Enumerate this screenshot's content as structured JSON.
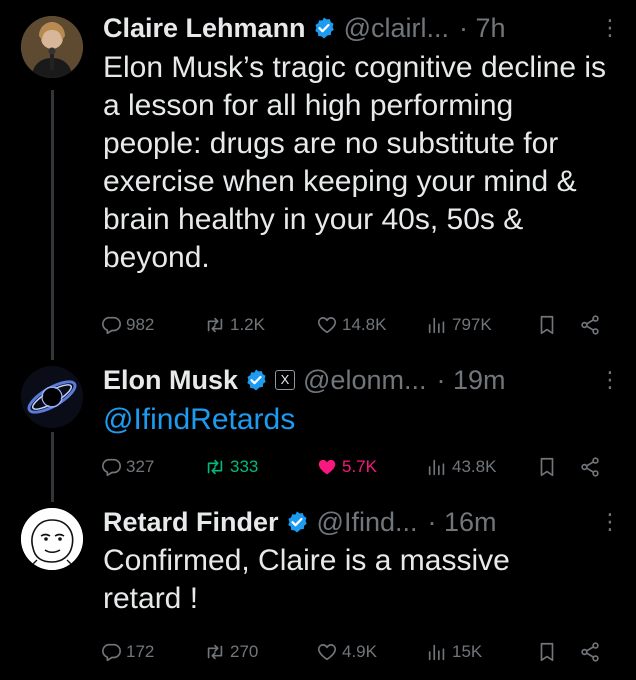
{
  "tweets": [
    {
      "name": "Claire Lehmann",
      "handle": "@clairl...",
      "time": "7h",
      "text": "Elon Musk’s tragic cognitive decline is a lesson for all high performing people: drugs are no substitute for exercise when keeping your mind & brain healthy in your 40s, 50s & beyond.",
      "stats": {
        "replies": "982",
        "retweets": "1.2K",
        "likes": "14.8K",
        "views": "797K"
      },
      "liked": false
    },
    {
      "name": "Elon Musk",
      "handle": "@elonm...",
      "time": "19m",
      "affiliate": "X",
      "text": "@IfindRetards",
      "stats": {
        "replies": "327",
        "retweets": "333",
        "likes": "5.7K",
        "views": "43.8K"
      },
      "liked": true,
      "retweeted": true
    },
    {
      "name": "Retard Finder",
      "handle": "@Ifind...",
      "time": "16m",
      "text": "Confirmed, Claire is a massive retard !",
      "stats": {
        "replies": "172",
        "retweets": "270",
        "likes": "4.9K",
        "views": "15K"
      },
      "liked": false
    }
  ],
  "colors": {
    "background": "#000000",
    "text": "#e7e9ea",
    "muted": "#71767b",
    "accent": "#1d9bf0",
    "like": "#f91880",
    "retweet": "#00ba7c",
    "verified": "#1d9bf0"
  }
}
